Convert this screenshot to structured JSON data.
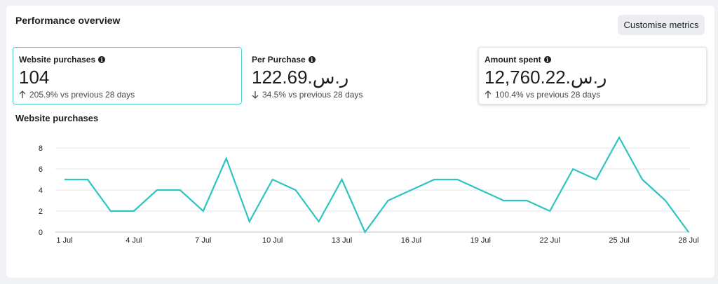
{
  "panel": {
    "title": "Performance overview",
    "customise_label": "Customise metrics"
  },
  "metrics": [
    {
      "label": "Website purchases",
      "value": "104",
      "direction": "up",
      "change": "205.9% vs previous 28 days"
    },
    {
      "label": "Per Purchase",
      "value": "122.69.ر.س",
      "direction": "down",
      "change": "34.5% vs previous 28 days"
    },
    {
      "label": "Amount spent",
      "value": "12,760.22.ر.س",
      "direction": "up",
      "change": "100.4% vs previous 28 days"
    }
  ],
  "colors": {
    "accent": "#2ec4c0",
    "selected_border": "#4fd1c5",
    "grid": "#e4e6eb"
  },
  "chart_data": {
    "type": "line",
    "title": "Website purchases",
    "x": [
      "1 Jul",
      "2 Jul",
      "3 Jul",
      "4 Jul",
      "5 Jul",
      "6 Jul",
      "7 Jul",
      "8 Jul",
      "9 Jul",
      "10 Jul",
      "11 Jul",
      "12 Jul",
      "13 Jul",
      "14 Jul",
      "15 Jul",
      "16 Jul",
      "17 Jul",
      "18 Jul",
      "19 Jul",
      "20 Jul",
      "21 Jul",
      "22 Jul",
      "23 Jul",
      "24 Jul",
      "25 Jul",
      "26 Jul",
      "27 Jul",
      "28 Jul"
    ],
    "values": [
      5,
      5,
      2,
      2,
      4,
      4,
      2,
      7,
      1,
      5,
      4,
      1,
      5,
      0,
      3,
      4,
      5,
      5,
      4,
      3,
      3,
      2,
      6,
      5,
      9,
      5,
      3,
      0
    ],
    "x_tick_labels": [
      "1 Jul",
      "4 Jul",
      "7 Jul",
      "10 Jul",
      "13 Jul",
      "16 Jul",
      "19 Jul",
      "22 Jul",
      "25 Jul",
      "28 Jul"
    ],
    "y_ticks": [
      0,
      2,
      4,
      6,
      8
    ],
    "ylim": [
      0,
      9
    ],
    "grid": true
  }
}
